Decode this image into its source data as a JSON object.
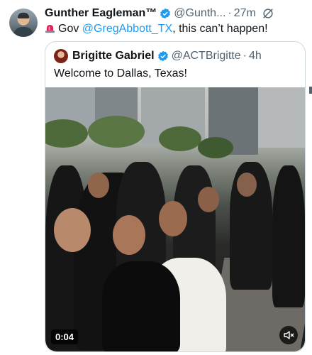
{
  "tweet": {
    "author_name": "Gunther Eagleman™",
    "author_handle": "@Gunth...",
    "time": "27m",
    "text_prefix": "Gov ",
    "mention": "@GregAbbott_TX",
    "text_suffix": ", this can’t happen!"
  },
  "quoted": {
    "author_name": "Brigitte Gabriel",
    "author_handle": "@ACTBrigitte",
    "time": "4h",
    "text": "Welcome to Dallas, Texas!"
  },
  "video": {
    "duration": "0:04"
  },
  "icons": {
    "verified": "verified-badge-icon",
    "grok": "grok-icon",
    "siren": "siren-emoji-icon",
    "mute": "muted-speaker-icon"
  },
  "colors": {
    "accent": "#1d9bf0",
    "secondary_text": "#536471",
    "border": "#cfd9de"
  }
}
